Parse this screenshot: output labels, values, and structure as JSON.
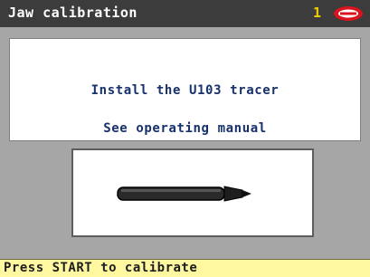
{
  "title_bar": {
    "title": "Jaw calibration",
    "counter": "1",
    "logo_icon": "silca-logo-icon"
  },
  "message_panel": {
    "line1": "Install the U103 tracer",
    "line2": "See operating manual"
  },
  "illustration": {
    "icon": "u103-tracer-icon"
  },
  "status_bar": {
    "text": "Press START to calibrate"
  },
  "colors": {
    "title_background": "#3c3c3c",
    "counter": "#f0d000",
    "message_text": "#17316d",
    "status_background": "#fff8a0",
    "body_background": "#a6a6a6"
  }
}
